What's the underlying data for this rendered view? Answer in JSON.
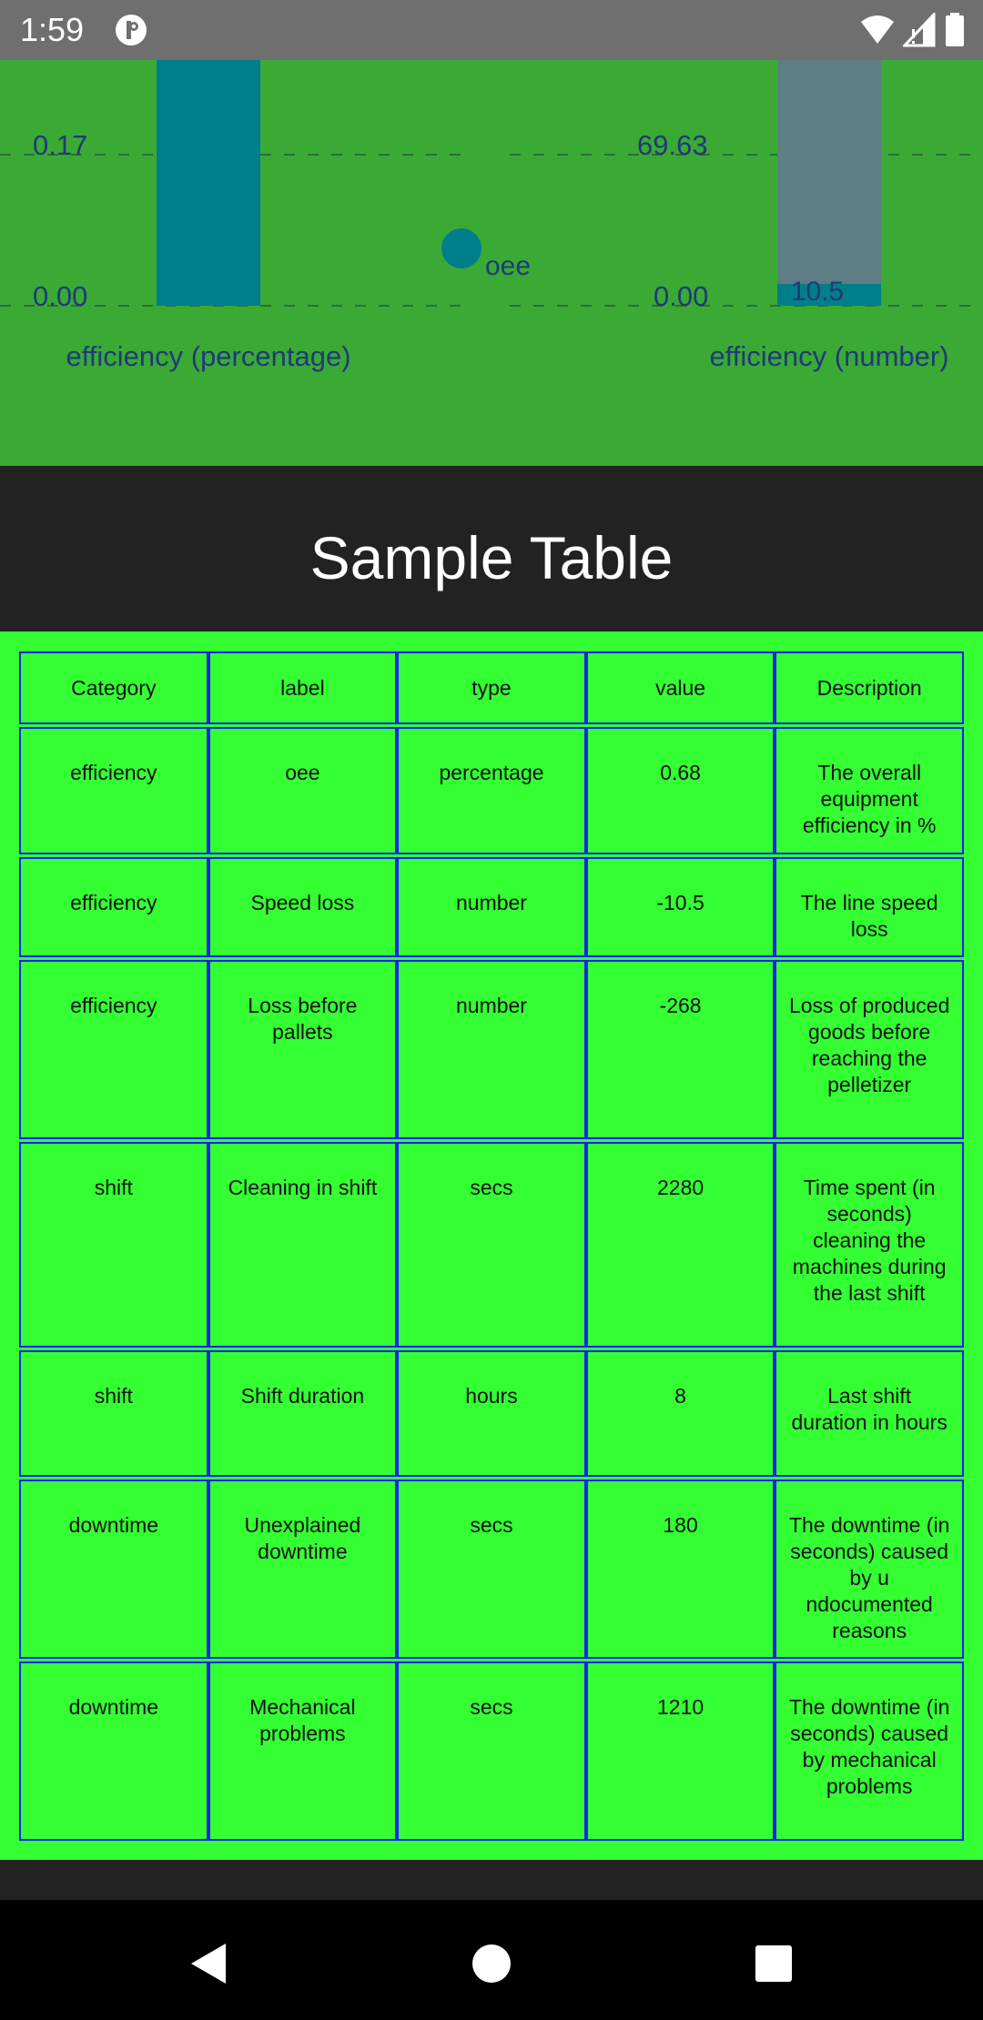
{
  "status_bar": {
    "time": "1:59",
    "icons": [
      "app-notification-icon",
      "wifi-icon",
      "cell-signal-icon",
      "battery-icon"
    ]
  },
  "chart_data": [
    {
      "type": "bar",
      "categories": [
        "oee"
      ],
      "series": [
        {
          "name": "oee",
          "values": [
            0.68
          ]
        }
      ],
      "ylabel": "efficiency (percentage)",
      "tick_labels": [
        "0.00",
        "0.17"
      ],
      "grid": true,
      "color": "#007f8a"
    },
    {
      "type": "bar",
      "categories": [
        "Speed loss",
        "Loss before pallets"
      ],
      "series": [
        {
          "values": [
            -10.5,
            -268
          ]
        }
      ],
      "ylabel": "efficiency (number)",
      "tick_labels": [
        "0.00",
        "69.63"
      ],
      "data_labels": [
        "10.5"
      ],
      "grid": true,
      "colors": [
        "#007f8a",
        "#607d8b"
      ]
    }
  ],
  "legend_label": "oee",
  "title": "Sample Table",
  "table": {
    "headers": [
      "Category",
      "label",
      "type",
      "value",
      "Description"
    ],
    "rows": [
      [
        "efficiency",
        "oee",
        "percentage",
        "0.68",
        "The overall equipment efficiency in %"
      ],
      [
        "efficiency",
        "Speed loss",
        "number",
        "-10.5",
        "The line speed loss"
      ],
      [
        "efficiency",
        "Loss before pallets",
        "number",
        "-268",
        "Loss of produced goods before reaching the pelletizer"
      ],
      [
        "shift",
        "Cleaning in shift",
        "secs",
        "2280",
        "Time spent (in seconds) cleaning the machines during the last shift"
      ],
      [
        "shift",
        "Shift duration",
        "hours",
        "8",
        "Last shift duration in hours"
      ],
      [
        "downtime",
        "Unexplained downtime",
        "secs",
        "180",
        "The downtime (in seconds) caused by u ndocumented reasons"
      ],
      [
        "downtime",
        "Mechanical problems",
        "secs",
        "1210",
        "The downtime (in seconds) caused by mechanical problems"
      ]
    ]
  },
  "colors": {
    "chart_bg": "#3aaa35",
    "table_bg": "#33ff33",
    "cell_border": "#1a22ee",
    "dark_bg": "#232223"
  },
  "nav": {
    "icons": [
      "back-icon",
      "home-icon",
      "recents-icon"
    ]
  }
}
